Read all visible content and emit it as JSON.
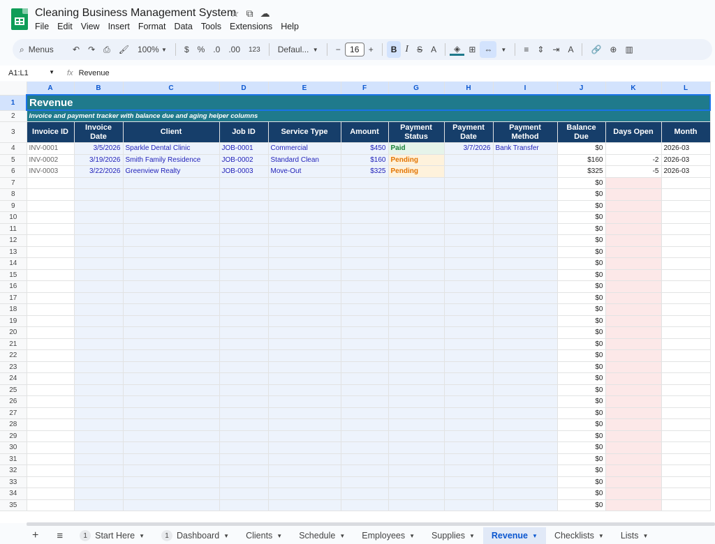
{
  "app": {
    "title": "Cleaning Business Management System",
    "menu": [
      "File",
      "Edit",
      "View",
      "Insert",
      "Format",
      "Data",
      "Tools",
      "Extensions",
      "Help"
    ]
  },
  "toolbar": {
    "menus_label": "Menus",
    "zoom": "100%",
    "currency": "$",
    "percent": "%",
    "dec_dec": ".0",
    "inc_dec": ".00",
    "format_123": "123",
    "font": "Defaul...",
    "font_size": "16",
    "bold": "B",
    "italic": "I",
    "strike": "S",
    "text_color": "A"
  },
  "formula": {
    "range": "A1:L1",
    "fx": "fx",
    "content": "Revenue"
  },
  "columns": [
    "A",
    "B",
    "C",
    "D",
    "E",
    "F",
    "G",
    "H",
    "I",
    "J",
    "K",
    "L"
  ],
  "sheet": {
    "title": "Revenue",
    "subtitle": "Invoice and payment tracker with balance due and aging helper columns",
    "headers": [
      "Invoice ID",
      "Invoice Date",
      "Client",
      "Job ID",
      "Service Type",
      "Amount",
      "Payment Status",
      "Payment Date",
      "Payment Method",
      "Balance Due",
      "Days Open",
      "Month"
    ],
    "rows": [
      [
        "INV-0001",
        "3/5/2026",
        "Sparkle Dental Clinic",
        "JOB-0001",
        "Commercial",
        "$450",
        "Paid",
        "3/7/2026",
        "Bank Transfer",
        "$0",
        "",
        "2026-03"
      ],
      [
        "INV-0002",
        "3/19/2026",
        "Smith Family Residence",
        "JOB-0002",
        "Standard Clean",
        "$160",
        "Pending",
        "",
        "",
        "$160",
        "-2",
        "2026-03"
      ],
      [
        "INV-0003",
        "3/22/2026",
        "Greenview Realty",
        "JOB-0003",
        "Move-Out",
        "$325",
        "Pending",
        "",
        "",
        "$325",
        "-5",
        "2026-03"
      ]
    ],
    "empty_balance": "$0",
    "row_numbers": [
      "1",
      "2",
      "3",
      "4",
      "5",
      "6",
      "7",
      "8",
      "9",
      "10",
      "11",
      "12",
      "13",
      "14",
      "15",
      "16",
      "17",
      "18",
      "19",
      "20",
      "21",
      "22",
      "23",
      "24",
      "25",
      "26",
      "27",
      "28",
      "29",
      "30",
      "31",
      "32",
      "33",
      "34",
      "35"
    ]
  },
  "tabs": [
    {
      "label": "Start Here",
      "badge": "1"
    },
    {
      "label": "Dashboard",
      "badge": "1"
    },
    {
      "label": "Clients",
      "badge": ""
    },
    {
      "label": "Schedule",
      "badge": ""
    },
    {
      "label": "Employees",
      "badge": ""
    },
    {
      "label": "Supplies",
      "badge": ""
    },
    {
      "label": "Revenue",
      "badge": "",
      "active": true
    },
    {
      "label": "Checklists",
      "badge": ""
    },
    {
      "label": "Lists",
      "badge": ""
    }
  ],
  "colors": {
    "title_bg": "#1f7a8c",
    "header_bg": "#163e6a",
    "paid": "#188038",
    "pending": "#e37400",
    "accent": "#0b57d0"
  }
}
